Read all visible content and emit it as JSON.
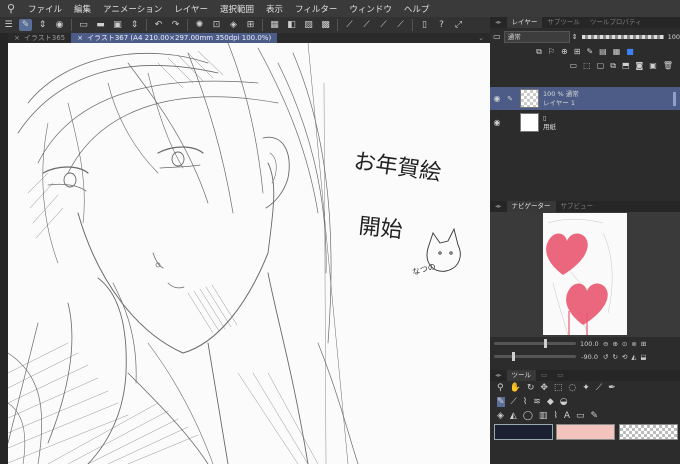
{
  "menu": {
    "items": [
      "ファイル",
      "編集",
      "アニメーション",
      "レイヤー",
      "選択範囲",
      "表示",
      "フィルター",
      "ウィンドウ",
      "ヘルプ"
    ]
  },
  "tabs": [
    {
      "label": "イラスト365"
    },
    {
      "label": "イラスト367 (A4 210.00×297.00mm 350dpi 100.0%)"
    }
  ],
  "canvas": {
    "text_line1": "お年賀絵",
    "text_line2": "開始",
    "signature": "なつの"
  },
  "layer_panel": {
    "tabs": [
      "レイヤー",
      "サブツール",
      "ツールプロパティ"
    ],
    "blend_mode": "通常",
    "opacity": "100",
    "layers": [
      {
        "line1": "100 % 通常",
        "line2": "レイヤー 1",
        "selected": true
      },
      {
        "line1": "",
        "line2": "用紙",
        "selected": false
      }
    ]
  },
  "navigator": {
    "tabs": [
      "ナビゲーター",
      "サブビュー"
    ],
    "zoom": "100.0",
    "rotation": "-90.0"
  },
  "tool_panel": {
    "tab": "ツール"
  },
  "colors": {
    "main": "#1c2033",
    "sub": "#f2c4bd",
    "heart": "#e85a73",
    "selection": "#4c5c86"
  }
}
